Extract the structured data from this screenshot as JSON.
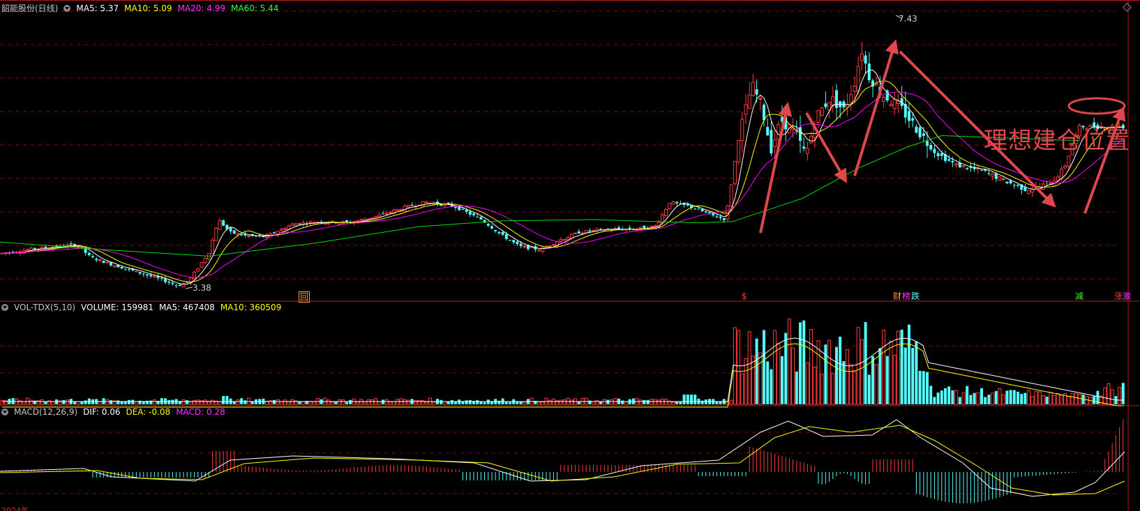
{
  "price_header": {
    "stock": "韶能股份(日线)",
    "ma5": "MA5: 5.37",
    "ma10": "MA10: 5.09",
    "ma20": "MA20: 4.99",
    "ma60": "MA60: 5.44"
  },
  "volume_header": {
    "name": "VOL-TDX(5,10)",
    "volume": "VOLUME: 159981",
    "ma5": "MA5: 467408",
    "ma10": "MA10: 360509"
  },
  "macd_header": {
    "name": "MACD(12,26,9)",
    "dif": "DIF: 0.06",
    "dea": "DEA: -0.08",
    "macd": "MACD: 0.28"
  },
  "annotation_text": "理想建仓位置",
  "event_tags": [
    "回",
    "$",
    "财",
    "榜",
    "跌",
    "减",
    "涨",
    "激"
  ],
  "x_axis_label": "2024年",
  "colors": {
    "up": "#ff3c3c",
    "down": "#54fcfc",
    "ma5": "#ffffff",
    "ma10": "#ffff00",
    "ma20": "#ff00ff",
    "ma60": "#00e000",
    "grid": "#8b0000",
    "annotation": "#e0474c"
  },
  "chart_data": [
    {
      "type": "candlestick",
      "title": "韶能股份(日线)",
      "series": [
        {
          "name": "MA5",
          "last": 5.37
        },
        {
          "name": "MA10",
          "last": 5.09
        },
        {
          "name": "MA20",
          "last": 4.99
        },
        {
          "name": "MA60",
          "last": 5.44
        }
      ],
      "high_label": 7.43,
      "low_label": 3.38,
      "price_series": [
        {
          "x": 0,
          "p": 3.92
        },
        {
          "x": 40,
          "p": 3.98
        },
        {
          "x": 80,
          "p": 4.03
        },
        {
          "x": 110,
          "p": 4.06
        },
        {
          "x": 130,
          "p": 3.86
        },
        {
          "x": 160,
          "p": 3.75
        },
        {
          "x": 200,
          "p": 3.62
        },
        {
          "x": 230,
          "p": 3.52
        },
        {
          "x": 255,
          "p": 3.42
        },
        {
          "x": 270,
          "p": 3.48
        },
        {
          "x": 300,
          "p": 3.95
        },
        {
          "x": 313,
          "p": 4.45
        },
        {
          "x": 330,
          "p": 4.25
        },
        {
          "x": 350,
          "p": 4.2
        },
        {
          "x": 380,
          "p": 4.18
        },
        {
          "x": 420,
          "p": 4.38
        },
        {
          "x": 460,
          "p": 4.42
        },
        {
          "x": 500,
          "p": 4.4
        },
        {
          "x": 540,
          "p": 4.5
        },
        {
          "x": 580,
          "p": 4.64
        },
        {
          "x": 610,
          "p": 4.72
        },
        {
          "x": 650,
          "p": 4.66
        },
        {
          "x": 690,
          "p": 4.45
        },
        {
          "x": 720,
          "p": 4.2
        },
        {
          "x": 745,
          "p": 4.03
        },
        {
          "x": 775,
          "p": 3.98
        },
        {
          "x": 800,
          "p": 4.12
        },
        {
          "x": 830,
          "p": 4.25
        },
        {
          "x": 870,
          "p": 4.3
        },
        {
          "x": 910,
          "p": 4.3
        },
        {
          "x": 940,
          "p": 4.35
        },
        {
          "x": 960,
          "p": 4.72
        },
        {
          "x": 990,
          "p": 4.65
        },
        {
          "x": 1020,
          "p": 4.52
        },
        {
          "x": 1040,
          "p": 4.45
        },
        {
          "x": 1060,
          "p": 5.8
        },
        {
          "x": 1078,
          "p": 6.55
        },
        {
          "x": 1092,
          "p": 6.2
        },
        {
          "x": 1105,
          "p": 5.55
        },
        {
          "x": 1120,
          "p": 6.0
        },
        {
          "x": 1140,
          "p": 5.8
        },
        {
          "x": 1155,
          "p": 5.45
        },
        {
          "x": 1170,
          "p": 6.05
        },
        {
          "x": 1190,
          "p": 6.35
        },
        {
          "x": 1210,
          "p": 6.15
        },
        {
          "x": 1225,
          "p": 6.6
        },
        {
          "x": 1235,
          "p": 7.1
        },
        {
          "x": 1245,
          "p": 6.7
        },
        {
          "x": 1265,
          "p": 6.4
        },
        {
          "x": 1290,
          "p": 6.2
        },
        {
          "x": 1315,
          "p": 5.85
        },
        {
          "x": 1340,
          "p": 5.5
        },
        {
          "x": 1370,
          "p": 5.3
        },
        {
          "x": 1410,
          "p": 5.2
        },
        {
          "x": 1440,
          "p": 5.05
        },
        {
          "x": 1470,
          "p": 4.92
        },
        {
          "x": 1490,
          "p": 4.96
        },
        {
          "x": 1510,
          "p": 5.06
        },
        {
          "x": 1525,
          "p": 5.25
        },
        {
          "x": 1540,
          "p": 5.7
        },
        {
          "x": 1548,
          "p": 5.9
        }
      ],
      "ma60_series": [
        {
          "x": 0,
          "p": 4.1
        },
        {
          "x": 150,
          "p": 3.98
        },
        {
          "x": 300,
          "p": 3.88
        },
        {
          "x": 450,
          "p": 4.08
        },
        {
          "x": 600,
          "p": 4.34
        },
        {
          "x": 720,
          "p": 4.43
        },
        {
          "x": 850,
          "p": 4.45
        },
        {
          "x": 1000,
          "p": 4.4
        },
        {
          "x": 1050,
          "p": 4.42
        },
        {
          "x": 1150,
          "p": 4.78
        },
        {
          "x": 1230,
          "p": 5.25
        },
        {
          "x": 1300,
          "p": 5.58
        },
        {
          "x": 1350,
          "p": 5.76
        },
        {
          "x": 1450,
          "p": 5.72
        },
        {
          "x": 1548,
          "p": 5.68
        }
      ]
    },
    {
      "type": "bar",
      "title": "VOL-TDX(5,10)",
      "series": [
        {
          "name": "VOLUME",
          "last": 159981
        },
        {
          "name": "MA5",
          "last": 467408
        },
        {
          "name": "MA10",
          "last": 360509
        }
      ]
    },
    {
      "type": "bar",
      "title": "MACD(12,26,9)",
      "series": [
        {
          "name": "DIF",
          "last": 0.06
        },
        {
          "name": "DEA",
          "last": -0.08
        },
        {
          "name": "MACD",
          "last": 0.28
        }
      ]
    }
  ]
}
